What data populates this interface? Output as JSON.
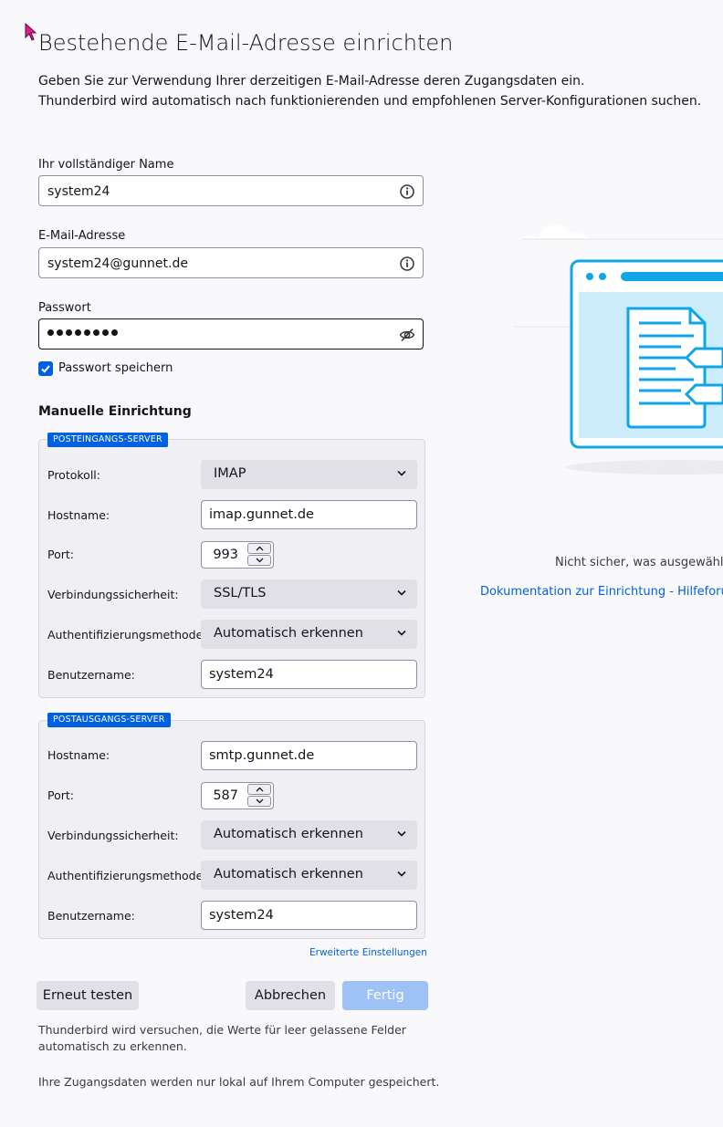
{
  "page": {
    "title": "Bestehende E-Mail-Adresse einrichten",
    "intro_line1": "Geben Sie zur Verwendung Ihrer derzeitigen E-Mail-Adresse deren Zugangsdaten ein.",
    "intro_line2": "Thunderbird wird automatisch nach funktionierenden und empfohlenen Server-Konfigurationen suchen."
  },
  "account": {
    "name_label": "Ihr vollständiger Name",
    "name_value": "system24",
    "email_label": "E-Mail-Adresse",
    "email_value": "system24@gunnet.de",
    "password_label": "Passwort",
    "password_mask_length": 8,
    "remember_label": "Passwort speichern",
    "remember_checked": true
  },
  "manual": {
    "heading": "Manuelle Einrichtung",
    "incoming": {
      "legend": "POSTEINGANGS-SERVER",
      "protocol_label": "Protokoll:",
      "protocol_value": "IMAP",
      "hostname_label": "Hostname:",
      "hostname_value": "imap.gunnet.de",
      "port_label": "Port:",
      "port_value": "993",
      "security_label": "Verbindungssicherheit:",
      "security_value": "SSL/TLS",
      "auth_label": "Authentifizierungsmethode:",
      "auth_value": "Automatisch erkennen",
      "username_label": "Benutzername:",
      "username_value": "system24"
    },
    "outgoing": {
      "legend": "POSTAUSGANGS-SERVER",
      "hostname_label": "Hostname:",
      "hostname_value": "smtp.gunnet.de",
      "port_label": "Port:",
      "port_value": "587",
      "security_label": "Verbindungssicherheit:",
      "security_value": "Automatisch erkennen",
      "auth_label": "Authentifizierungsmethode:",
      "auth_value": "Automatisch erkennen",
      "username_label": "Benutzername:",
      "username_value": "system24"
    },
    "advanced_link": "Erweiterte Einstellungen"
  },
  "buttons": {
    "retest": "Erneut testen",
    "cancel": "Abbrechen",
    "done": "Fertig"
  },
  "footnotes": {
    "line1": "Thunderbird wird versuchen, die Werte für leer gelassene Felder",
    "line2": "automatisch zu erkennen.",
    "line3": "Ihre Zugangsdaten werden nur lokal auf Ihrem Computer gespeichert."
  },
  "side": {
    "unsure_text": "Nicht sicher, was ausgewählt w",
    "doc_link": "Dokumentation zur Einrichtung",
    "separator": " - ",
    "forum_link": "Hilfeforum"
  },
  "colors": {
    "accent": "#0061e0",
    "illustration": "#0ea5e9",
    "background": "#f9f9fb"
  },
  "icons": {
    "name_field": "info-icon",
    "email_field": "info-icon",
    "password_field": "eye-slash-icon"
  }
}
